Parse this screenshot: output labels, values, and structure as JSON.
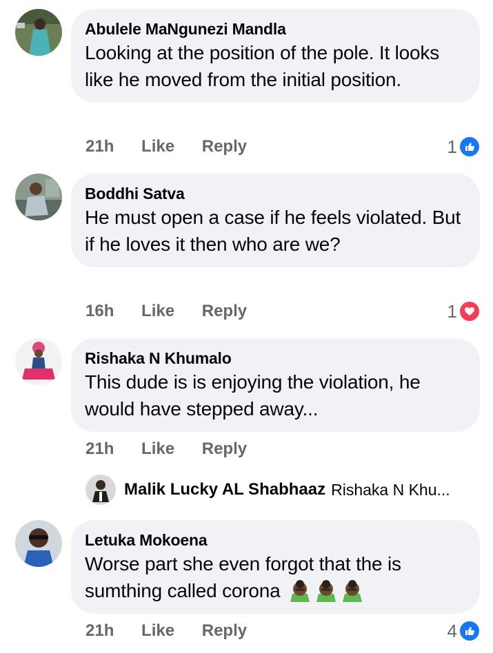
{
  "comments": [
    {
      "author": "Abulele MaNgunezi Mandla",
      "text": "Looking at the position of the pole. It looks like he moved from the initial position.",
      "time": "21h",
      "like_label": "Like",
      "reply_label": "Reply",
      "reaction_count": "1",
      "reaction_type": "like-icon"
    },
    {
      "author": "Boddhi Satva",
      "text": "He must open a case if he feels violated. But if he loves it then who are we?",
      "time": "16h",
      "like_label": "Like",
      "reply_label": "Reply",
      "reaction_count": "1",
      "reaction_type": "love-icon"
    },
    {
      "author": "Rishaka N Khumalo",
      "text": "This dude is is enjoying the violation, he would have stepped away...",
      "time": "21h",
      "like_label": "Like",
      "reply_label": "Reply"
    },
    {
      "author": "Letuka Mokoena",
      "text": "Worse part she even forgot that the is sumthing called corona",
      "time": "21h",
      "like_label": "Like",
      "reply_label": "Reply",
      "reaction_count": "4",
      "reaction_type": "like-icon",
      "emojis": [
        "see-no-evil-gesture-icon",
        "see-no-evil-gesture-icon",
        "see-no-evil-gesture-icon"
      ]
    }
  ],
  "reply_preview": {
    "author": "Malik Lucky AL Shabhaaz",
    "snippet": "Rishaka N Khu..."
  },
  "colors": {
    "bubble": "#f0f2f5",
    "meta_text": "#65676b",
    "like_blue": "#1877f2",
    "love_red": "#f33e58"
  }
}
